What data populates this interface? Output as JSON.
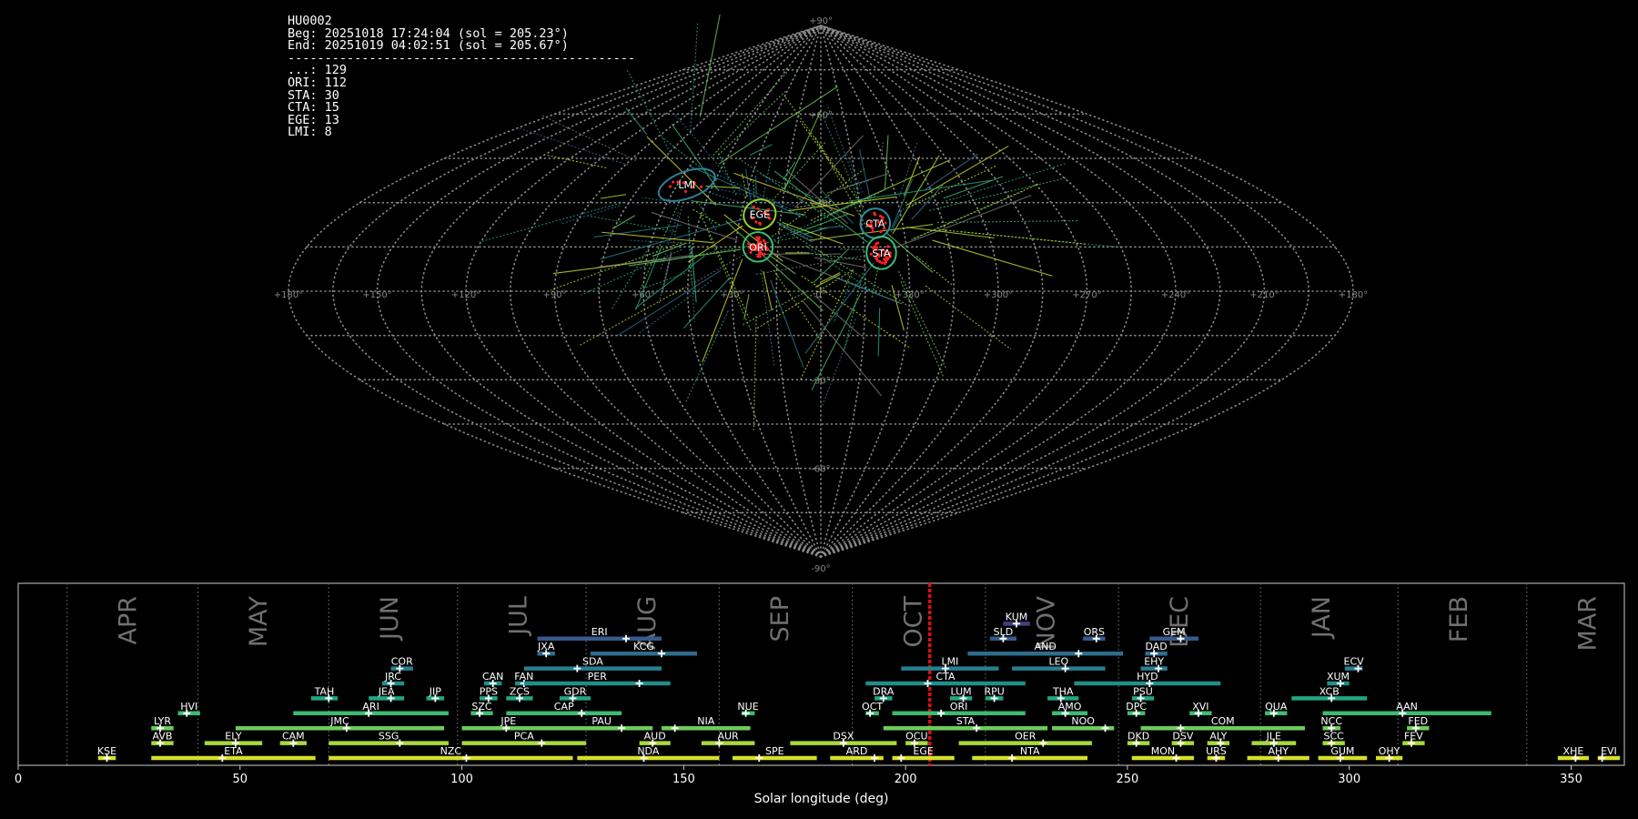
{
  "stats": {
    "station": "HU0002",
    "begin": "Beg: 20251018 17:24:04 (sol = 205.23°)",
    "end": "End: 20251019 04:02:51 (sol = 205.67°)",
    "separator": "-----------------------------------------------",
    "counts": [
      {
        "code": "...",
        "count": 129
      },
      {
        "code": "ORI",
        "count": 112
      },
      {
        "code": "STA",
        "count": 30
      },
      {
        "code": "CTA",
        "count": 15
      },
      {
        "code": "EGE",
        "count": 13
      },
      {
        "code": "LMI",
        "count": 8
      }
    ]
  },
  "colors": {
    "background": "#000000",
    "grid": "#8a8a8a",
    "marker": "#ff2020",
    "current_sol": "#dd1111",
    "month_label": "#707070",
    "frame": "#cccccc"
  },
  "chart_data": [
    {
      "type": "scatter",
      "projection": "sinusoidal",
      "description_of_axes": "radiant map in sun-centred longitude and latitude",
      "longitude_labels": [
        "+180°",
        "+150°",
        "+120°",
        "+90°",
        "+60°",
        "+30°",
        "0°",
        "+330°",
        "+300°",
        "+270°",
        "+240°",
        "+210°",
        "+180°"
      ],
      "latitude_labels": [
        "+90°",
        "+60°",
        "+30°",
        "-30°",
        "-60°",
        "-90°"
      ],
      "showers": [
        {
          "code": "LMI",
          "lon": 146,
          "lat": 36,
          "ring_color": "#2f7d9c",
          "ring_size": [
            10,
            4.5
          ],
          "count": 8
        },
        {
          "code": "EGE",
          "lon": 113,
          "lat": 26,
          "ring_color": "#9acd32",
          "ring_size": [
            5.5,
            5
          ],
          "count": 13
        },
        {
          "code": "ORI",
          "lon": 112,
          "lat": 15,
          "ring_color": "#3cbb75",
          "ring_size": [
            5,
            5
          ],
          "count": 112
        },
        {
          "code": "CTA",
          "lon": 70,
          "lat": 23,
          "ring_color": "#2e8da0",
          "ring_size": [
            5,
            5
          ],
          "count": 15
        },
        {
          "code": "STA",
          "lon": 69,
          "lat": 13,
          "ring_color": "#3cbb75",
          "ring_size": [
            5,
            5.5
          ],
          "count": 30
        }
      ]
    },
    {
      "type": "timeline",
      "xlabel": "Solar longitude (deg)",
      "xlim": [
        0,
        362
      ],
      "xticks": [
        0,
        50,
        100,
        150,
        200,
        250,
        300,
        350
      ],
      "current_sol": 205.45,
      "months": [
        {
          "name": "APR",
          "start": 11
        },
        {
          "name": "MAY",
          "start": 40.5
        },
        {
          "name": "JUN",
          "start": 70
        },
        {
          "name": "JUL",
          "start": 99
        },
        {
          "name": "AUG",
          "start": 128
        },
        {
          "name": "SEP",
          "start": 158
        },
        {
          "name": "OCT",
          "start": 188
        },
        {
          "name": "NOV",
          "start": 218
        },
        {
          "name": "DEC",
          "start": 248
        },
        {
          "name": "JAN",
          "start": 280
        },
        {
          "name": "FEB",
          "start": 311
        },
        {
          "name": "MAR",
          "start": 340
        }
      ],
      "showers": [
        {
          "code": "KUM",
          "start": 222,
          "end": 228,
          "peak": 225,
          "row": 10
        },
        {
          "code": "ERI",
          "start": 117,
          "end": 145,
          "peak": 137,
          "row": 9
        },
        {
          "code": "SLD",
          "start": 219,
          "end": 225,
          "peak": 222,
          "row": 9
        },
        {
          "code": "ORS",
          "start": 240,
          "end": 245,
          "peak": 243,
          "row": 9
        },
        {
          "code": "GEM",
          "start": 255,
          "end": 266,
          "peak": 262,
          "row": 9
        },
        {
          "code": "JXA",
          "start": 117,
          "end": 121,
          "peak": 119,
          "row": 8
        },
        {
          "code": "KCG",
          "start": 129,
          "end": 153,
          "peak": 145,
          "row": 8
        },
        {
          "code": "AND",
          "start": 214,
          "end": 249,
          "peak": 239,
          "row": 8
        },
        {
          "code": "DAD",
          "start": 254,
          "end": 259,
          "peak": 256,
          "row": 8
        },
        {
          "code": "COR",
          "start": 84,
          "end": 89,
          "peak": 86,
          "row": 7
        },
        {
          "code": "SDA",
          "start": 114,
          "end": 145,
          "peak": 126,
          "row": 7
        },
        {
          "code": "LMI",
          "start": 199,
          "end": 221,
          "peak": 209,
          "row": 7
        },
        {
          "code": "LEO",
          "start": 224,
          "end": 245,
          "peak": 236,
          "row": 7
        },
        {
          "code": "EHY",
          "start": 253,
          "end": 259,
          "peak": 257,
          "row": 7
        },
        {
          "code": "ECV",
          "start": 299,
          "end": 303,
          "peak": 302,
          "row": 7
        },
        {
          "code": "JRC",
          "start": 82,
          "end": 87,
          "peak": 84,
          "row": 6
        },
        {
          "code": "CAN",
          "start": 105,
          "end": 109,
          "peak": 107,
          "row": 6
        },
        {
          "code": "FAN",
          "start": 112,
          "end": 116,
          "peak": 114,
          "row": 6
        },
        {
          "code": "PER",
          "start": 114,
          "end": 147,
          "peak": 140,
          "row": 6
        },
        {
          "code": "CTA",
          "start": 191,
          "end": 227,
          "peak": 205,
          "row": 6
        },
        {
          "code": "HYD",
          "start": 238,
          "end": 271,
          "peak": 255,
          "row": 6
        },
        {
          "code": "XUM",
          "start": 295,
          "end": 300,
          "peak": 298,
          "row": 6
        },
        {
          "code": "TAH",
          "start": 66,
          "end": 72,
          "peak": 70,
          "row": 5
        },
        {
          "code": "JEA",
          "start": 79,
          "end": 87,
          "peak": 84,
          "row": 5
        },
        {
          "code": "JIP",
          "start": 92,
          "end": 96,
          "peak": 94,
          "row": 5
        },
        {
          "code": "PPS",
          "start": 104,
          "end": 108,
          "peak": 106,
          "row": 5
        },
        {
          "code": "ZCS",
          "start": 110,
          "end": 116,
          "peak": 113,
          "row": 5
        },
        {
          "code": "GDR",
          "start": 122,
          "end": 129,
          "peak": 125,
          "row": 5
        },
        {
          "code": "DRA",
          "start": 193,
          "end": 197,
          "peak": 195,
          "row": 5
        },
        {
          "code": "LUM",
          "start": 210,
          "end": 215,
          "peak": 213,
          "row": 5
        },
        {
          "code": "RPU",
          "start": 218,
          "end": 222,
          "peak": 220,
          "row": 5
        },
        {
          "code": "THA",
          "start": 232,
          "end": 239,
          "peak": 235,
          "row": 5
        },
        {
          "code": "PSU",
          "start": 251,
          "end": 256,
          "peak": 253,
          "row": 5
        },
        {
          "code": "XCB",
          "start": 287,
          "end": 304,
          "peak": 296,
          "row": 5
        },
        {
          "code": "HVI",
          "start": 36,
          "end": 41,
          "peak": 38,
          "row": 4
        },
        {
          "code": "ARI",
          "start": 62,
          "end": 97,
          "peak": 79,
          "row": 4
        },
        {
          "code": "SZC",
          "start": 102,
          "end": 107,
          "peak": 104,
          "row": 4
        },
        {
          "code": "CAP",
          "start": 110,
          "end": 136,
          "peak": 127,
          "row": 4
        },
        {
          "code": "NUE",
          "start": 163,
          "end": 166,
          "peak": 164,
          "row": 4
        },
        {
          "code": "OCT",
          "start": 191,
          "end": 194,
          "peak": 192,
          "row": 4
        },
        {
          "code": "ORI",
          "start": 197,
          "end": 227,
          "peak": 208,
          "row": 4
        },
        {
          "code": "AMO",
          "start": 233,
          "end": 241,
          "peak": 236,
          "row": 4
        },
        {
          "code": "DPC",
          "start": 250,
          "end": 254,
          "peak": 252,
          "row": 4
        },
        {
          "code": "XVI",
          "start": 264,
          "end": 269,
          "peak": 266,
          "row": 4
        },
        {
          "code": "QUA",
          "start": 281,
          "end": 286,
          "peak": 283,
          "row": 4
        },
        {
          "code": "AAN",
          "start": 294,
          "end": 332,
          "peak": 312,
          "row": 4
        },
        {
          "code": "LYR",
          "start": 30,
          "end": 35,
          "peak": 32,
          "row": 3
        },
        {
          "code": "JMC",
          "start": 49,
          "end": 96,
          "peak": 74,
          "row": 3
        },
        {
          "code": "JPE",
          "start": 100,
          "end": 121,
          "peak": 110,
          "row": 3
        },
        {
          "code": "PAU",
          "start": 120,
          "end": 143,
          "peak": 136,
          "row": 3
        },
        {
          "code": "NIA",
          "start": 145,
          "end": 165,
          "peak": 148,
          "row": 3
        },
        {
          "code": "STA",
          "start": 195,
          "end": 232,
          "peak": 216,
          "row": 3
        },
        {
          "code": "NOO",
          "start": 233,
          "end": 247,
          "peak": 245,
          "row": 3
        },
        {
          "code": "COM",
          "start": 253,
          "end": 290,
          "peak": 262,
          "row": 3
        },
        {
          "code": "NCC",
          "start": 294,
          "end": 298,
          "peak": 296,
          "row": 3
        },
        {
          "code": "FED",
          "start": 313,
          "end": 318,
          "peak": 315,
          "row": 3
        },
        {
          "code": "AVB",
          "start": 30,
          "end": 35,
          "peak": 32,
          "row": 2
        },
        {
          "code": "ELY",
          "start": 42,
          "end": 55,
          "peak": 49,
          "row": 2
        },
        {
          "code": "CAM",
          "start": 59,
          "end": 65,
          "peak": 62,
          "row": 2
        },
        {
          "code": "SSG",
          "start": 70,
          "end": 97,
          "peak": 86,
          "row": 2
        },
        {
          "code": "PCA",
          "start": 100,
          "end": 128,
          "peak": 118,
          "row": 2
        },
        {
          "code": "AUD",
          "start": 140,
          "end": 147,
          "peak": 143,
          "row": 2
        },
        {
          "code": "AUR",
          "start": 154,
          "end": 166,
          "peak": 158,
          "row": 2
        },
        {
          "code": "DSX",
          "start": 174,
          "end": 198,
          "peak": 186,
          "row": 2
        },
        {
          "code": "OCU",
          "start": 200,
          "end": 205,
          "peak": 202,
          "row": 2
        },
        {
          "code": "OER",
          "start": 212,
          "end": 242,
          "peak": 231,
          "row": 2
        },
        {
          "code": "DKD",
          "start": 250,
          "end": 255,
          "peak": 252,
          "row": 2
        },
        {
          "code": "DSV",
          "start": 260,
          "end": 265,
          "peak": 262,
          "row": 2
        },
        {
          "code": "ALY",
          "start": 268,
          "end": 273,
          "peak": 271,
          "row": 2
        },
        {
          "code": "JLE",
          "start": 278,
          "end": 288,
          "peak": 283,
          "row": 2
        },
        {
          "code": "SCC",
          "start": 294,
          "end": 299,
          "peak": 296,
          "row": 2
        },
        {
          "code": "FEV",
          "start": 312,
          "end": 317,
          "peak": 314,
          "row": 2
        },
        {
          "code": "KSE",
          "start": 18,
          "end": 22,
          "peak": 20,
          "row": 1
        },
        {
          "code": "ETA",
          "start": 30,
          "end": 67,
          "peak": 46,
          "row": 1
        },
        {
          "code": "NZC",
          "start": 70,
          "end": 125,
          "peak": 101,
          "row": 1
        },
        {
          "code": "NDA",
          "start": 126,
          "end": 158,
          "peak": 141,
          "row": 1
        },
        {
          "code": "SPE",
          "start": 161,
          "end": 180,
          "peak": 167,
          "row": 1
        },
        {
          "code": "ARD",
          "start": 183,
          "end": 195,
          "peak": 193,
          "row": 1
        },
        {
          "code": "EGE",
          "start": 197,
          "end": 211,
          "peak": 199,
          "row": 1
        },
        {
          "code": "NTA",
          "start": 215,
          "end": 241,
          "peak": 224,
          "row": 1
        },
        {
          "code": "MON",
          "start": 251,
          "end": 265,
          "peak": 261,
          "row": 1
        },
        {
          "code": "URS",
          "start": 268,
          "end": 272,
          "peak": 270,
          "row": 1
        },
        {
          "code": "AHY",
          "start": 277,
          "end": 291,
          "peak": 284,
          "row": 1
        },
        {
          "code": "GUM",
          "start": 293,
          "end": 304,
          "peak": 298,
          "row": 1
        },
        {
          "code": "OHY",
          "start": 306,
          "end": 312,
          "peak": 309,
          "row": 1
        },
        {
          "code": "XHE",
          "start": 347,
          "end": 354,
          "peak": 351,
          "row": 1
        },
        {
          "code": "EVI",
          "start": 356,
          "end": 361,
          "peak": 357,
          "row": 1
        }
      ],
      "row_colors": [
        "#d4e02a",
        "#a8da3a",
        "#6ccc5a",
        "#3cbb75",
        "#23a583",
        "#1f8f8c",
        "#277f8e",
        "#2f6d8e",
        "#38598c",
        "#424285"
      ]
    }
  ]
}
